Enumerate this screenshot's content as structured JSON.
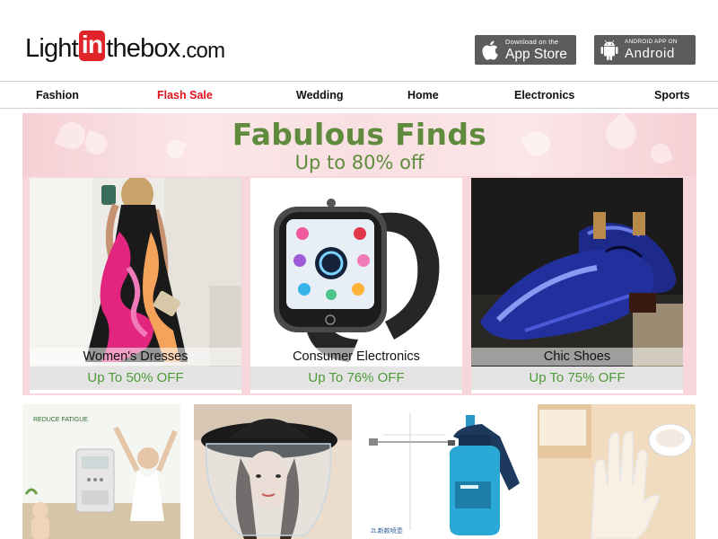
{
  "header": {
    "logo": {
      "part1": "Light",
      "part2": "in",
      "part3": "thebox",
      "part4": ".com"
    },
    "app_store": {
      "small": "Download on the",
      "big": "App Store",
      "icon": "apple-icon"
    },
    "android": {
      "small": "ANDROID APP ON",
      "big": "Android",
      "icon": "android-icon"
    }
  },
  "nav": {
    "items": [
      {
        "label": "Fashion"
      },
      {
        "label": "Flash Sale"
      },
      {
        "label": "Wedding"
      },
      {
        "label": "Home"
      },
      {
        "label": "Electronics"
      },
      {
        "label": "Sports"
      }
    ]
  },
  "banner": {
    "title": "Fabulous Finds",
    "subtitle": "Up to 80% off",
    "cards": [
      {
        "category": "Women's Dresses",
        "discount": "Up To 50% OFF"
      },
      {
        "category": "Consumer Electronics",
        "discount": "Up To 76% OFF"
      },
      {
        "category": "Chic Shoes",
        "discount": "Up To 75% OFF"
      }
    ]
  },
  "products": {
    "tile1": {
      "label": "REDUCE FATIGUE"
    },
    "tile3": {
      "label": "2L新款喷壶"
    }
  },
  "colors": {
    "brand_red": "#e0242a",
    "flash_red": "#e0101a",
    "banner_green": "#5f8c3c",
    "discount_green": "#4f9a3a",
    "badge_gray": "#5c5c5c"
  }
}
